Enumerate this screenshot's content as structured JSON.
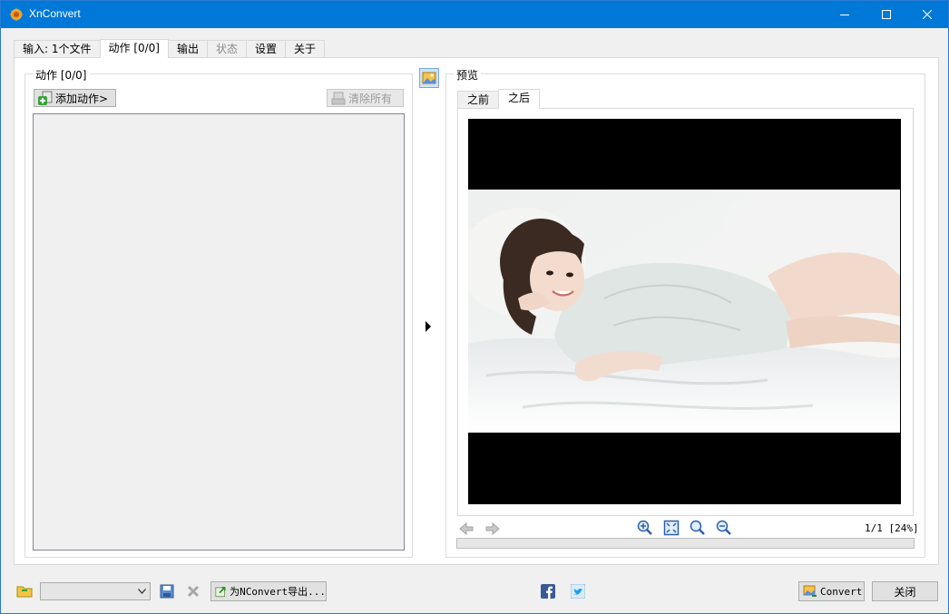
{
  "window": {
    "title": "XnConvert"
  },
  "tabs": [
    {
      "label": "输入: 1个文件"
    },
    {
      "label": "动作 [0/0]"
    },
    {
      "label": "输出"
    },
    {
      "label": "状态"
    },
    {
      "label": "设置"
    },
    {
      "label": "关于"
    }
  ],
  "actions_panel": {
    "group_title": "动作 [0/0]",
    "add_button": "添加动作>",
    "clear_button": "清除所有"
  },
  "preview_panel": {
    "group_title": "预览",
    "subtabs": [
      {
        "label": "之前"
      },
      {
        "label": "之后"
      }
    ],
    "page_zoom": "1/1 [24%]"
  },
  "bottom_bar": {
    "export_button": "为NConvert导出...",
    "convert_button": "Convert",
    "close_button": "关闭",
    "preset_value": ""
  },
  "colors": {
    "titlebar": "#0078d7",
    "accent": "#2b79d4"
  },
  "icons": [
    "app-icon",
    "minimize-icon",
    "maximize-icon",
    "close-icon",
    "toggle-preview-icon",
    "collapse-arrow-icon",
    "prev-icon",
    "next-icon",
    "zoom-in-icon",
    "fit-icon",
    "zoom-icon",
    "zoom-out-icon",
    "folder-icon",
    "save-icon",
    "delete-icon",
    "facebook-icon",
    "twitter-icon"
  ]
}
